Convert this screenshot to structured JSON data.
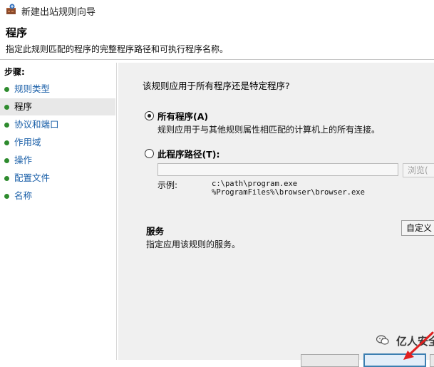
{
  "window": {
    "title": "新建出站规则向导"
  },
  "header": {
    "title": "程序",
    "description": "指定此规则匹配的程序的完整程序路径和可执行程序名称。"
  },
  "sidebar": {
    "steps_label": "步骤:",
    "items": [
      {
        "label": "规则类型",
        "active": false
      },
      {
        "label": "程序",
        "active": true
      },
      {
        "label": "协议和端口",
        "active": false
      },
      {
        "label": "作用域",
        "active": false
      },
      {
        "label": "操作",
        "active": false
      },
      {
        "label": "配置文件",
        "active": false
      },
      {
        "label": "名称",
        "active": false
      }
    ]
  },
  "main": {
    "question": "该规则应用于所有程序还是特定程序?",
    "all_programs": {
      "label": "所有程序(A)",
      "description": "规则应用于与其他规则属性相匹配的计算机上的所有连接。",
      "checked": true
    },
    "program_path": {
      "label": "此程序路径(T):",
      "checked": false,
      "input_value": "",
      "browse_label": "浏览("
    },
    "example": {
      "label": "示例:",
      "lines": [
        "c:\\path\\program.exe",
        "%ProgramFiles%\\browser\\browser.exe"
      ]
    },
    "services": {
      "title": "服务",
      "description": "指定应用该规则的服务。",
      "customize_label": "自定义"
    }
  },
  "footer": {
    "back_label": "",
    "next_label": "",
    "cancel_label": ""
  },
  "watermark": {
    "text": "亿人安全"
  },
  "colors": {
    "step_dot": "#2e8b2e",
    "step_link": "#1a5fa8",
    "content_bg": "#f0f0f0",
    "annotation_arrow": "#e02020",
    "next_button_border": "#3c7fb1"
  }
}
